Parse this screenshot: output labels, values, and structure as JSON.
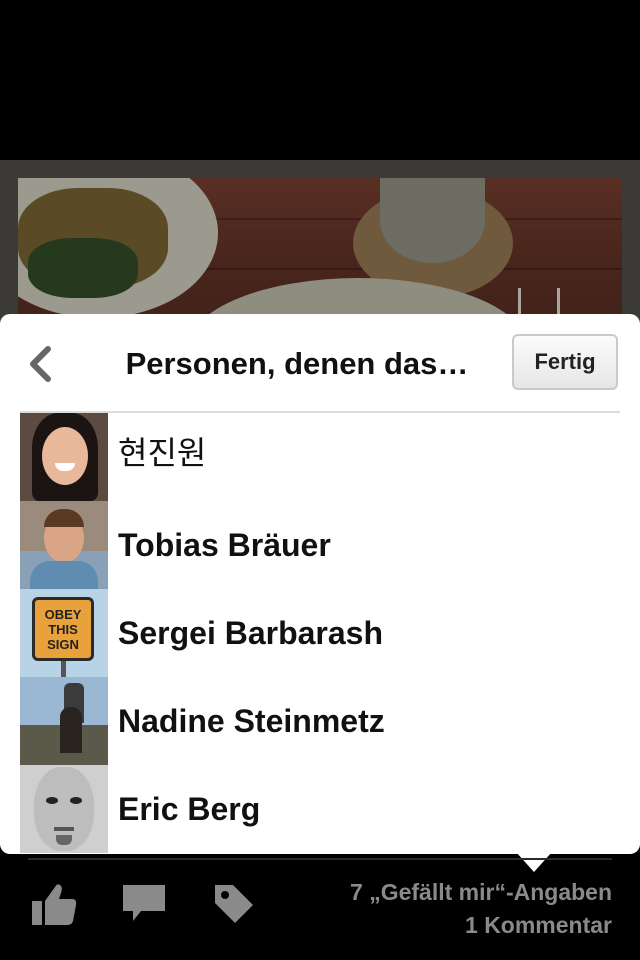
{
  "popup": {
    "title": "Personen, denen das…",
    "done_label": "Fertig",
    "back_icon": "chevron-left-icon"
  },
  "people": [
    {
      "name": "현진원"
    },
    {
      "name": "Tobias Bräuer"
    },
    {
      "name": "Sergei Barbarash",
      "avatar_text": [
        "OBEY",
        "THIS",
        "SIGN"
      ]
    },
    {
      "name": "Nadine Steinmetz"
    },
    {
      "name": "Eric Berg"
    }
  ],
  "bottom_bar": {
    "icons": [
      "thumbs-up-icon",
      "comment-icon",
      "tag-icon"
    ],
    "likes_text": "7 „Gefällt mir“-Angaben",
    "comments_text": "1 Kommentar"
  },
  "colors": {
    "background": "#000000",
    "card": "#ffffff",
    "icon_gray": "#8a8a8a"
  }
}
